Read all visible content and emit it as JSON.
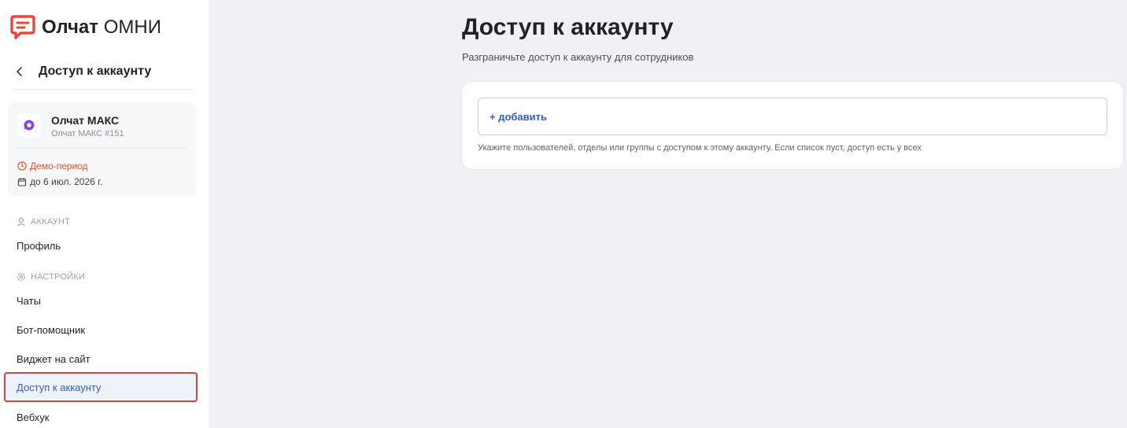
{
  "brand": {
    "name_bold": "Олчат",
    "name_regular": "ОМНИ",
    "color": "#e8473a"
  },
  "sidebar": {
    "back_title": "Доступ к аккаунту",
    "account": {
      "name": "Олчат МАКС",
      "sub": "Олчат МАКС #151",
      "demo_label": "Демо-период",
      "until": "до 6 июл. 2026 г."
    },
    "section_account": "АККАУНТ",
    "section_settings": "НАСТРОЙКИ",
    "items": {
      "profile": "Профиль",
      "chats": "Чаты",
      "bot": "Бот-помощник",
      "widget": "Виджет на сайт",
      "access": "Доступ к аккаунту",
      "webhook": "Вебхук"
    }
  },
  "main": {
    "title": "Доступ к аккаунту",
    "subtitle": "Разграничьте доступ к аккаунту для сотрудников",
    "add_label": "+ добавить",
    "hint": "Укажите пользователей, отделы или группы с доступом к этому аккаунту. Если список пуст, доступ есть у всех"
  },
  "colors": {
    "accent": "#2e5fc7",
    "warning": "#e0542b",
    "highlight_border": "#d9433a"
  }
}
